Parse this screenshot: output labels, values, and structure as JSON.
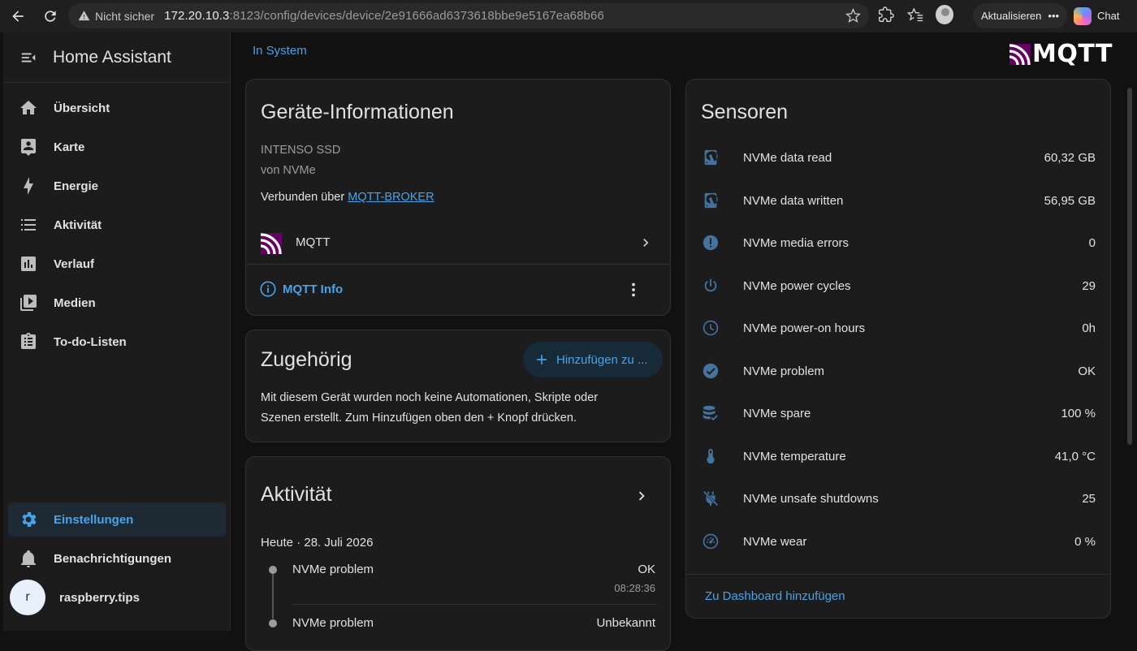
{
  "browser": {
    "security_label": "Nicht sicher",
    "url_host": "172.20.10.3",
    "url_rest": ":8123/config/devices/device/2e91666ad6373618bbe9e5167ea68b66",
    "update_label": "Aktualisieren",
    "chat_label": "Chat"
  },
  "sidebar": {
    "title": "Home Assistant",
    "items": [
      {
        "label": "Übersicht",
        "icon": "home-icon"
      },
      {
        "label": "Karte",
        "icon": "map-account-icon"
      },
      {
        "label": "Energie",
        "icon": "lightning-icon"
      },
      {
        "label": "Aktivität",
        "icon": "list-icon"
      },
      {
        "label": "Verlauf",
        "icon": "chart-box-icon"
      },
      {
        "label": "Medien",
        "icon": "play-box-icon"
      },
      {
        "label": "To-do-Listen",
        "icon": "clipboard-list-icon"
      }
    ],
    "settings_label": "Einstellungen",
    "notifications_label": "Benachrichtigungen",
    "user_initial": "r",
    "user_name": "raspberry.tips"
  },
  "colors": {
    "accent": "#48a3e8",
    "background": "#111111",
    "card": "#1c1c1c",
    "text": "#e1e1e1"
  },
  "main": {
    "breadcrumb": "In System",
    "brand": "MQTT"
  },
  "device_info": {
    "title": "Geräte-Informationen",
    "model": "INTENSO SSD",
    "manufacturer": "von NVMe",
    "connected_prefix": "Verbunden über ",
    "connected_link": "MQTT-BROKER",
    "integration_label": "MQTT",
    "info_button": "MQTT Info"
  },
  "related": {
    "title": "Zugehörig",
    "add_button": "Hinzufügen zu ...",
    "text_line1": "Mit diesem Gerät wurden noch keine Automationen, Skripte oder",
    "text_line2": "Szenen erstellt. Zum Hinzufügen oben den + Knopf drücken."
  },
  "activity": {
    "title": "Aktivität",
    "date_header": "Heute · 28. Juli 2026",
    "entries": [
      {
        "name": "NVMe problem",
        "state": "OK",
        "time": "08:28:36"
      },
      {
        "name": "NVMe problem",
        "state": "Unbekannt"
      }
    ]
  },
  "sensors": {
    "title": "Sensoren",
    "rows": [
      {
        "name": "NVMe data read",
        "value": "60,32 GB",
        "icon": "harddisk-icon"
      },
      {
        "name": "NVMe data written",
        "value": "56,95 GB",
        "icon": "harddisk-icon"
      },
      {
        "name": "NVMe media errors",
        "value": "0",
        "icon": "alert-circle-icon"
      },
      {
        "name": "NVMe power cycles",
        "value": "29",
        "icon": "power-icon"
      },
      {
        "name": "NVMe power-on hours",
        "value": "0h",
        "icon": "clock-icon"
      },
      {
        "name": "NVMe problem",
        "value": "OK",
        "icon": "check-circle-icon"
      },
      {
        "name": "NVMe spare",
        "value": "100 %",
        "icon": "database-check-icon"
      },
      {
        "name": "NVMe temperature",
        "value": "41,0 °C",
        "icon": "thermometer-icon"
      },
      {
        "name": "NVMe unsafe shutdowns",
        "value": "25",
        "icon": "power-plug-off-icon"
      },
      {
        "name": "NVMe wear",
        "value": "0 %",
        "icon": "gauge-icon"
      }
    ],
    "add_to_dashboard": "Zu Dashboard hinzufügen"
  }
}
